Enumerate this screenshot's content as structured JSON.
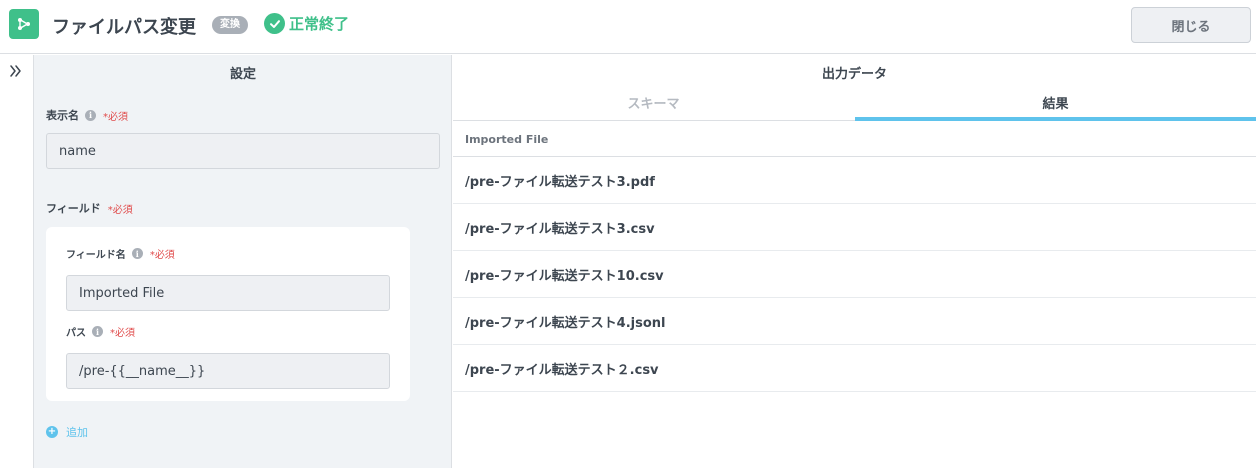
{
  "header": {
    "title": "ファイルパス変更",
    "badge": "変換",
    "status": "正常終了",
    "close_label": "閉じる",
    "icon": "flow-branch-icon",
    "accent_color": "#3fc08a"
  },
  "settings": {
    "title": "設定",
    "display_name": {
      "label": "表示名",
      "required": "*必須",
      "value": "name"
    },
    "fields": {
      "label": "フィールド",
      "required": "*必須",
      "field_name": {
        "label": "フィールド名",
        "required": "*必須",
        "value": "Imported File"
      },
      "path": {
        "label": "パス",
        "required": "*必須",
        "value": "/pre-{{__name__}}"
      }
    },
    "add_label": "追加"
  },
  "output": {
    "title": "出力データ",
    "tabs": [
      {
        "label": "スキーマ",
        "active": false
      },
      {
        "label": "結果",
        "active": true
      }
    ],
    "column_header": "Imported File",
    "rows": [
      "/pre-ファイル転送テスト3.pdf",
      "/pre-ファイル転送テスト3.csv",
      "/pre-ファイル転送テスト10.csv",
      "/pre-ファイル転送テスト4.jsonl",
      "/pre-ファイル転送テスト２.csv"
    ],
    "accent_color": "#5fc3ec"
  }
}
